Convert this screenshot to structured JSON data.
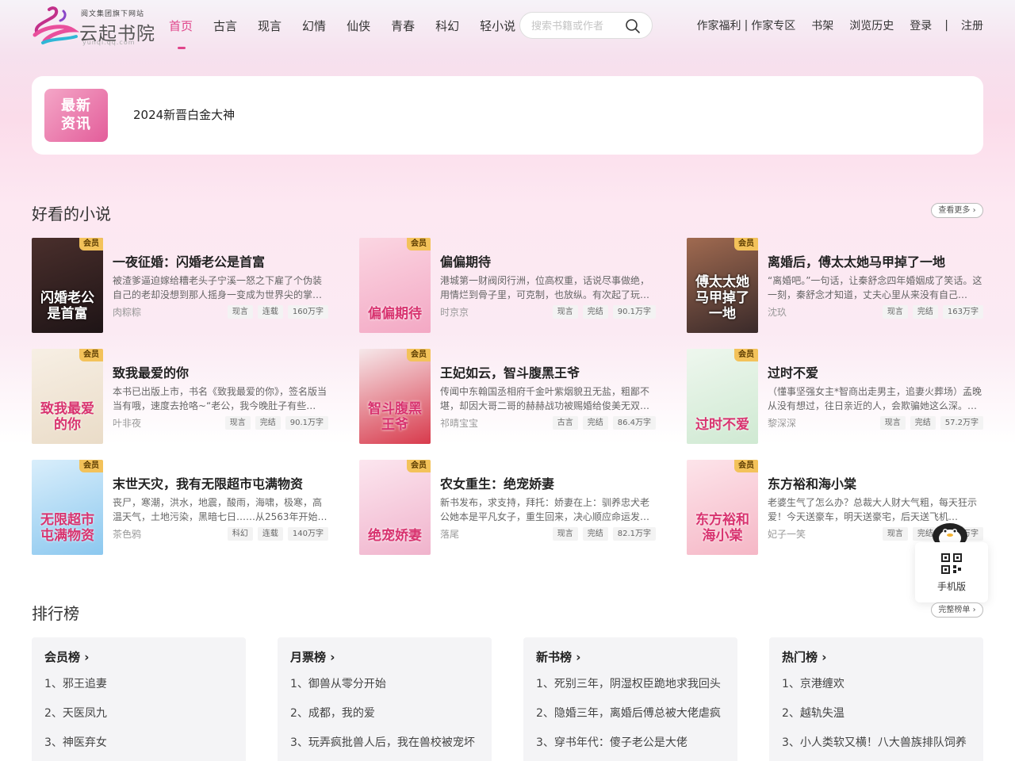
{
  "header": {
    "logo": {
      "top": "阅文集团旗下网站",
      "main": "云起书院",
      "sub": "yunqi.qq.com"
    },
    "nav": [
      "首页",
      "古言",
      "现言",
      "幻情",
      "仙侠",
      "青春",
      "科幻",
      "轻小说"
    ],
    "search_placeholder": "搜索书籍或作者",
    "links": {
      "welfare": "作家福利",
      "divider": "|",
      "zone": "作家专区",
      "shelf": "书架",
      "history": "浏览历史",
      "login": "登录",
      "login_sep": "|",
      "register": "注册"
    }
  },
  "news": {
    "badge_line1": "最新",
    "badge_line2": "资讯",
    "text": "2024新晋白金大神"
  },
  "recommend": {
    "title": "好看的小说",
    "more": "查看更多 ›",
    "vip_label": "会员",
    "books": [
      {
        "title": "一夜征婚：闪婚老公是首富",
        "cover_text": "闪婚老公是首富",
        "desc": "被渣爹逼迫嫁给糟老头子宁溪一怒之下雇了个伪装自己的老却没想到那人摇身一变成为世界尖的掌…",
        "author": "肉粽粽",
        "genre": "现言",
        "status": "连载",
        "words": "160万字",
        "colors": [
          "#4a2f2c",
          "#1e1416"
        ]
      },
      {
        "title": "偏偏期待",
        "cover_text": "偏偏期待",
        "desc": "港城第一财阀闵行洲，位高权重，话说尽事做绝，用情烂到骨子里，可克制，也放纵。有次起了玩…",
        "author": "时京京",
        "genre": "现言",
        "status": "完结",
        "words": "90.1万字",
        "colors": [
          "#fbd6e2",
          "#f3a8c4"
        ]
      },
      {
        "title": "离婚后，傅太太她马甲掉了一地",
        "cover_text": "傅太太她马甲掉了一地",
        "desc": "“离婚吧。”一句话，让秦舒念四年婚姻成了笑话。这一刻，秦舒念才知道，丈夫心里从来没有自己…",
        "author": "沈玖",
        "genre": "现言",
        "status": "完结",
        "words": "163万字",
        "colors": [
          "#a06a50",
          "#3a2a2a"
        ]
      },
      {
        "title": "致我最爱的你",
        "cover_text": "致我最爱的你",
        "desc": "本书已出版上市，书名《致我最爱的你》，签名版当当有哦，速度去抢咯~“老公，我今晚肚子有些…",
        "author": "叶非夜",
        "genre": "现言",
        "status": "完结",
        "words": "90.1万字",
        "colors": [
          "#f7efe4",
          "#eadcc8"
        ]
      },
      {
        "title": "王妃如云，智斗腹黑王爷",
        "cover_text": "智斗腹黑王爷",
        "desc": "传闻中东翰国丞相府千金叶紫烟貌丑无盐，粗鄙不堪，却因大哥二哥的赫赫战功被赐婚给俊美无双…",
        "author": "祁晴宝宝",
        "genre": "古言",
        "status": "完结",
        "words": "86.4万字",
        "colors": [
          "#f6e8ea",
          "#d83a4c"
        ]
      },
      {
        "title": "过时不爱",
        "cover_text": "过时不爱",
        "desc": "（懂事坚强女主*智商出走男主，追妻火葬场）孟晚从没有想过，往日亲近的人，会欺骗她这么深。…",
        "author": "黎深深",
        "genre": "现言",
        "status": "完结",
        "words": "57.2万字",
        "colors": [
          "#eef7ee",
          "#cfe9d2"
        ]
      },
      {
        "title": "末世天灾，我有无限超市屯满物资",
        "cover_text": "无限超市屯满物资",
        "desc": "丧尸，寒潮，洪水，地震，酸雨，海啸，极寒，高温天气，土地污染，黑暗七日……从2563年开始…",
        "author": "茶色鸦",
        "genre": "科幻",
        "status": "连载",
        "words": "140万字",
        "colors": [
          "#d9eefb",
          "#8cc8ef"
        ]
      },
      {
        "title": "农女重生：绝宠娇妻",
        "cover_text": "绝宠娇妻",
        "desc": "新书发布，求支持，拜托：娇妻在上：驯养忠犬老公她本是平凡女子，重生回来，决心顺应命运发…",
        "author": "落尾",
        "genre": "现言",
        "status": "完结",
        "words": "82.1万字",
        "colors": [
          "#fce6ef",
          "#f0b3cc"
        ]
      },
      {
        "title": "东方裕和海小棠",
        "cover_text": "东方裕和海小棠",
        "desc": "老婆生气了怎么办？总裁大人财大气粗，每天狂示爱！今天送豪车，明天送豪宅，后天送飞机…",
        "author": "妃子一笑",
        "genre": "现言",
        "status": "完结",
        "words": "171万字",
        "colors": [
          "#fde4ea",
          "#f5b7c6"
        ]
      }
    ]
  },
  "phone": {
    "label": "手机版"
  },
  "ranking": {
    "title": "排行榜",
    "more": "完整榜单 ›",
    "lists": [
      {
        "title": "会员榜 ›",
        "items": [
          "1、邪王追妻",
          "2、天医凤九",
          "3、神医弃女"
        ]
      },
      {
        "title": "月票榜 ›",
        "items": [
          "1、御兽从零分开始",
          "2、成都，我的爱",
          "3、玩弄疯批兽人后，我在兽校被宠坏"
        ]
      },
      {
        "title": "新书榜 ›",
        "items": [
          "1、死别三年，阴湿权臣跪地求我回头",
          "2、隐婚三年，离婚后傅总被大佬虐疯",
          "3、穿书年代：傻子老公是大佬"
        ]
      },
      {
        "title": "热门榜 ›",
        "items": [
          "1、京港缠欢",
          "2、越轨失温",
          "3、小人类软又横！八大兽族排队饲养"
        ]
      }
    ]
  },
  "colors": {
    "accent": "#e0448a",
    "vip": "#f3c25a"
  }
}
